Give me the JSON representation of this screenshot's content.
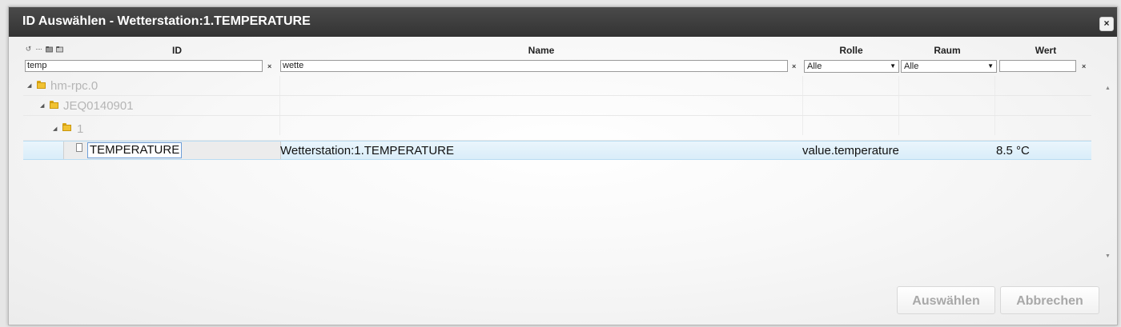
{
  "dialog": {
    "title": "ID Auswählen - Wetterstation:1.TEMPERATURE",
    "close_glyph": "×"
  },
  "toolbar": {
    "icons": [
      "refresh-icon",
      "collapse-icon",
      "folder-collapse-icon",
      "folder-expand-icon"
    ]
  },
  "columns": {
    "id": "ID",
    "name": "Name",
    "role": "Rolle",
    "room": "Raum",
    "value": "Wert"
  },
  "filters": {
    "id_value": "temp",
    "name_value": "wette",
    "role_selected": "Alle",
    "room_selected": "Alle",
    "value_value": "",
    "clear_glyph": "×",
    "select_arrow": "▼"
  },
  "tree": {
    "level0": "hm-rpc.0",
    "level1": "JEQ0140901",
    "level2": "1",
    "expander_glyph": "◢"
  },
  "selected_row": {
    "id": "TEMPERATURE",
    "name": "Wetterstation:1.TEMPERATURE",
    "role": "value.temperature",
    "value": "8.5 °C"
  },
  "scrollbar": {
    "up_glyph": "▲",
    "down_glyph": "▼"
  },
  "buttons": {
    "select": "Auswählen",
    "cancel": "Abbrechen"
  }
}
